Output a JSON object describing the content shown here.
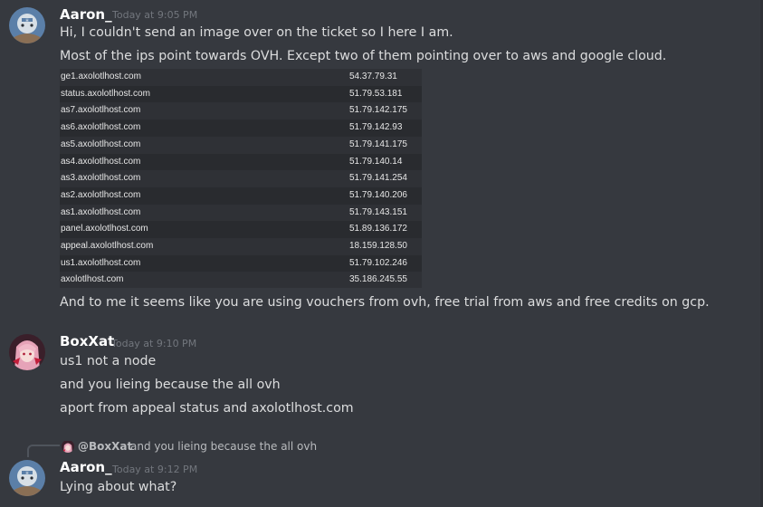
{
  "messages": [
    {
      "author": "Aaron_",
      "timestamp": "Today at 9:05 PM",
      "lines": [
        "Hi, I couldn't send an image over on the ticket so I here I am.",
        "Most of the ips point towards OVH. Except two of them pointing over to aws and google cloud."
      ],
      "after_lines": [
        "And to me it seems like you are using vouchers from ovh, free trial from aws and free credits on gcp."
      ]
    },
    {
      "author": "BoxXat",
      "timestamp": "Today at 9:10 PM",
      "lines": [
        "us1 not a node",
        "and you lieing because the all ovh",
        "aport from appeal status and axolotlhost.com"
      ]
    },
    {
      "reply": {
        "mention": "@BoxXat",
        "text": "and you lieing because the all ovh"
      },
      "author": "Aaron_",
      "timestamp": "Today at 9:12 PM",
      "lines": [
        "Lying about what?"
      ]
    }
  ],
  "ip_table": [
    {
      "host": "ge1.axolotlhost.com",
      "ip": "54.37.79.31"
    },
    {
      "host": "status.axolotlhost.com",
      "ip": "51.79.53.181"
    },
    {
      "host": "as7.axolotlhost.com",
      "ip": "51.79.142.175"
    },
    {
      "host": "as6.axolotlhost.com",
      "ip": "51.79.142.93"
    },
    {
      "host": "as5.axolotlhost.com",
      "ip": "51.79.141.175"
    },
    {
      "host": "as4.axolotlhost.com",
      "ip": "51.79.140.14"
    },
    {
      "host": "as3.axolotlhost.com",
      "ip": "51.79.141.254"
    },
    {
      "host": "as2.axolotlhost.com",
      "ip": "51.79.140.206"
    },
    {
      "host": "as1.axolotlhost.com",
      "ip": "51.79.143.151"
    },
    {
      "host": "panel.axolotlhost.com",
      "ip": "51.89.136.172"
    },
    {
      "host": "appeal.axolotlhost.com",
      "ip": "18.159.128.50"
    },
    {
      "host": "us1.axolotlhost.com",
      "ip": "51.79.102.246"
    },
    {
      "host": "axolotlhost.com",
      "ip": "35.186.245.55"
    }
  ],
  "colors": {
    "background": "#36393f",
    "username": "#ffffff",
    "timestamp": "#72767d",
    "message_text": "#dcddde"
  },
  "icons": [
    "axolotl-avatar-icon",
    "anime-avatar-icon",
    "reply-spine-icon"
  ]
}
